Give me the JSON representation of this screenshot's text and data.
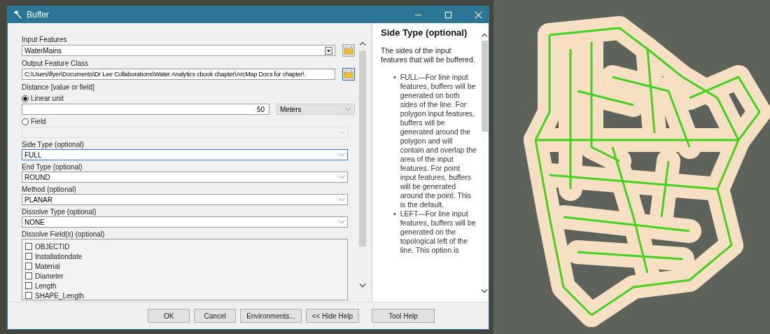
{
  "window": {
    "title": "Buffer"
  },
  "fields": [
    {
      "kind": "dropdown",
      "label": "Input Features",
      "value": "WaterMains",
      "browse": true,
      "focused": false
    },
    {
      "kind": "path",
      "label": "Output Feature Class",
      "value": "C:\\Users\\flyer\\Documents\\Dr Lee Collaborations\\Water Analytics cbook chapter\\ArcMap Docs for chapter\\",
      "browse": true,
      "focused": false
    },
    {
      "kind": "distance",
      "label": "Distance [value or field]",
      "options": [
        {
          "label": "Linear unit",
          "selected": true
        },
        {
          "label": "Field",
          "selected": false
        }
      ],
      "value": "50",
      "unit": "Meters"
    },
    {
      "kind": "select",
      "label": "Side Type (optional)",
      "value": "FULL",
      "focused": true
    },
    {
      "kind": "select",
      "label": "End Type (optional)",
      "value": "ROUND",
      "focused": false
    },
    {
      "kind": "select",
      "label": "Method (optional)",
      "value": "PLANAR",
      "focused": false
    },
    {
      "kind": "select",
      "label": "Dissolve Type (optional)",
      "value": "NONE",
      "focused": false
    },
    {
      "kind": "checklist",
      "label": "Dissolve Field(s) (optional)",
      "items": [
        {
          "label": "OBJECTID",
          "checked": false
        },
        {
          "label": "Installationdate",
          "checked": false
        },
        {
          "label": "Material",
          "checked": false
        },
        {
          "label": "Diameter",
          "checked": false
        },
        {
          "label": "Length",
          "checked": false
        },
        {
          "label": "SHAPE_Length",
          "checked": false
        }
      ]
    }
  ],
  "buttons": [
    "OK",
    "Cancel",
    "Environments...",
    "<< Hide Help"
  ],
  "help": {
    "title": "Side Type (optional)",
    "intro": "The sides of the input features that will be buffered.",
    "bullets": [
      {
        "marker": "•",
        "text": "FULL—For line input features, buffers will be generated on both sides of the line. For polygon input features, buffers will be generated around the polygon and will contain and overlap the area of the input features. For point input features, buffers will be generated around the point. This is the default."
      },
      {
        "marker": "•",
        "text": "LEFT—For line input features, buffers will be generated on the topological left of the line. This option is"
      }
    ],
    "button": "Tool Help"
  }
}
